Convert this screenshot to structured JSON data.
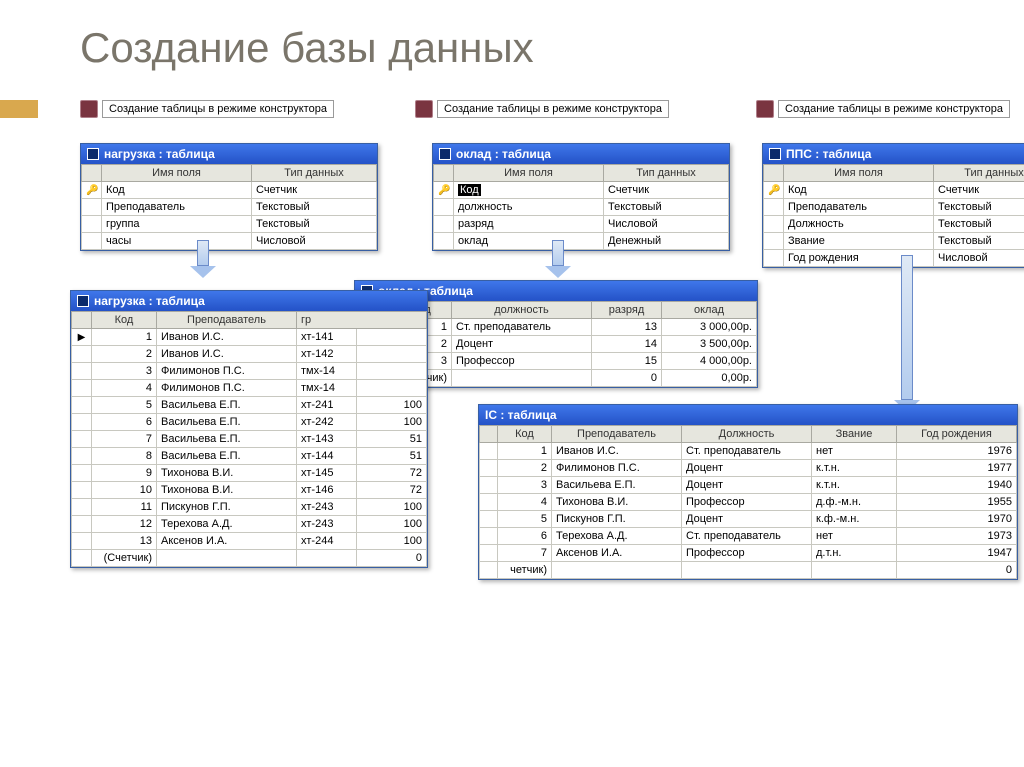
{
  "title": "Создание базы данных",
  "create_label": "Создание таблицы в режиме конструктора",
  "design": {
    "nagruzka": {
      "caption": "нагрузка : таблица",
      "col_field": "Имя поля",
      "col_type": "Тип данных",
      "rows": [
        {
          "key": "🔑",
          "name": "Код",
          "type": "Счетчик"
        },
        {
          "key": "",
          "name": "Преподаватель",
          "type": "Текстовый"
        },
        {
          "key": "",
          "name": "группа",
          "type": "Текстовый"
        },
        {
          "key": "",
          "name": "часы",
          "type": "Числовой"
        }
      ]
    },
    "oklad": {
      "caption": "оклад : таблица",
      "col_field": "Имя поля",
      "col_type": "Тип данных",
      "rows": [
        {
          "key": "🔑",
          "name": "Код",
          "type": "Счетчик",
          "sel": true
        },
        {
          "key": "",
          "name": "должность",
          "type": "Текстовый"
        },
        {
          "key": "",
          "name": "разряд",
          "type": "Числовой"
        },
        {
          "key": "",
          "name": "оклад",
          "type": "Денежный"
        }
      ]
    },
    "pps": {
      "caption": "ППС : таблица",
      "col_field": "Имя поля",
      "col_type": "Тип данных",
      "rows": [
        {
          "key": "🔑",
          "name": "Код",
          "type": "Счетчик"
        },
        {
          "key": "",
          "name": "Преподаватель",
          "type": "Текстовый"
        },
        {
          "key": "",
          "name": "Должность",
          "type": "Текстовый"
        },
        {
          "key": "",
          "name": "Звание",
          "type": "Текстовый"
        },
        {
          "key": "",
          "name": "Год рождения",
          "type": "Числовой"
        }
      ]
    }
  },
  "data": {
    "nagruzka": {
      "caption": "нагрузка : таблица",
      "headers": [
        "Код",
        "Преподаватель",
        "гр"
      ],
      "rows": [
        {
          "cur": "▶",
          "k": "1",
          "p": "Иванов И.С.",
          "g": "хт-141"
        },
        {
          "cur": "",
          "k": "2",
          "p": "Иванов И.С.",
          "g": "хт-142"
        },
        {
          "cur": "",
          "k": "3",
          "p": "Филимонов П.С.",
          "g": "тмх-14"
        },
        {
          "cur": "",
          "k": "4",
          "p": "Филимонов П.С.",
          "g": "тмх-14"
        },
        {
          "cur": "",
          "k": "5",
          "p": "Васильева Е.П.",
          "g": "хт-241",
          "h": "100"
        },
        {
          "cur": "",
          "k": "6",
          "p": "Васильева Е.П.",
          "g": "хт-242",
          "h": "100"
        },
        {
          "cur": "",
          "k": "7",
          "p": "Васильева Е.П.",
          "g": "хт-143",
          "h": "51"
        },
        {
          "cur": "",
          "k": "8",
          "p": "Васильева Е.П.",
          "g": "хт-144",
          "h": "51"
        },
        {
          "cur": "",
          "k": "9",
          "p": "Тихонова В.И.",
          "g": "хт-145",
          "h": "72"
        },
        {
          "cur": "",
          "k": "10",
          "p": "Тихонова В.И.",
          "g": "хт-146",
          "h": "72"
        },
        {
          "cur": "",
          "k": "11",
          "p": "Пискунов Г.П.",
          "g": "хт-243",
          "h": "100"
        },
        {
          "cur": "",
          "k": "12",
          "p": "Терехова А.Д.",
          "g": "хт-243",
          "h": "100"
        },
        {
          "cur": "",
          "k": "13",
          "p": "Аксенов И.А.",
          "g": "хт-244",
          "h": "100"
        },
        {
          "cur": "",
          "k": "(Счетчик)",
          "p": "",
          "g": "",
          "h": "0",
          "new": true
        }
      ]
    },
    "oklad": {
      "caption": "оклад : таблица",
      "headers": [
        "Код",
        "должность",
        "разряд",
        "оклад"
      ],
      "rows": [
        {
          "exp": "+",
          "k": "1",
          "d": "Ст. преподаватель",
          "r": "13",
          "o": "3 000,00р."
        },
        {
          "exp": "+",
          "k": "2",
          "d": "Доцент",
          "r": "14",
          "o": "3 500,00р."
        },
        {
          "exp": "+",
          "k": "3",
          "d": "Профессор",
          "r": "15",
          "o": "4 000,00р."
        },
        {
          "exp": "",
          "k": "(Счетчик)",
          "d": "",
          "r": "0",
          "o": "0,00р.",
          "new": true
        }
      ]
    },
    "pps": {
      "caption": "IC : таблица",
      "headers": [
        "Код",
        "Преподаватель",
        "Должность",
        "Звание",
        "Год рождения"
      ],
      "rows": [
        {
          "k": "1",
          "p": "Иванов И.С.",
          "d": "Ст. преподаватель",
          "z": "нет",
          "y": "1976"
        },
        {
          "k": "2",
          "p": "Филимонов П.С.",
          "d": "Доцент",
          "z": "к.т.н.",
          "y": "1977"
        },
        {
          "k": "3",
          "p": "Васильева Е.П.",
          "d": "Доцент",
          "z": "к.т.н.",
          "y": "1940"
        },
        {
          "k": "4",
          "p": "Тихонова В.И.",
          "d": "Профессор",
          "z": "д.ф.-м.н.",
          "y": "1955"
        },
        {
          "k": "5",
          "p": "Пискунов Г.П.",
          "d": "Доцент",
          "z": "к.ф.-м.н.",
          "y": "1970"
        },
        {
          "k": "6",
          "p": "Терехова А.Д.",
          "d": "Ст. преподаватель",
          "z": "нет",
          "y": "1973"
        },
        {
          "k": "7",
          "p": "Аксенов И.А.",
          "d": "Профессор",
          "z": "д.т.н.",
          "y": "1947"
        },
        {
          "k": "четчик)",
          "p": "",
          "d": "",
          "z": "",
          "y": "0",
          "new": true
        }
      ]
    }
  }
}
